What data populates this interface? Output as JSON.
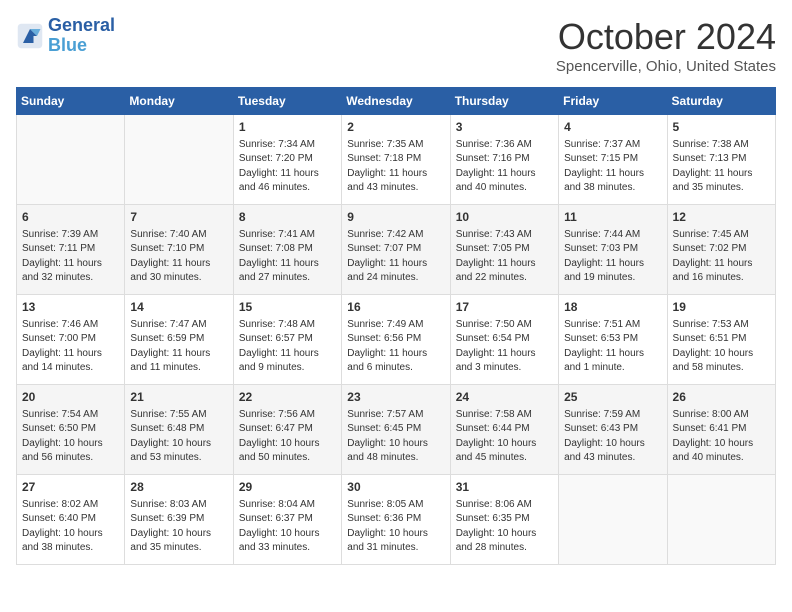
{
  "header": {
    "logo_line1": "General",
    "logo_line2": "Blue",
    "month_year": "October 2024",
    "location": "Spencerville, Ohio, United States"
  },
  "weekdays": [
    "Sunday",
    "Monday",
    "Tuesday",
    "Wednesday",
    "Thursday",
    "Friday",
    "Saturday"
  ],
  "weeks": [
    [
      null,
      null,
      {
        "day": 1,
        "sunrise": "7:34 AM",
        "sunset": "7:20 PM",
        "daylight": "11 hours and 46 minutes."
      },
      {
        "day": 2,
        "sunrise": "7:35 AM",
        "sunset": "7:18 PM",
        "daylight": "11 hours and 43 minutes."
      },
      {
        "day": 3,
        "sunrise": "7:36 AM",
        "sunset": "7:16 PM",
        "daylight": "11 hours and 40 minutes."
      },
      {
        "day": 4,
        "sunrise": "7:37 AM",
        "sunset": "7:15 PM",
        "daylight": "11 hours and 38 minutes."
      },
      {
        "day": 5,
        "sunrise": "7:38 AM",
        "sunset": "7:13 PM",
        "daylight": "11 hours and 35 minutes."
      }
    ],
    [
      {
        "day": 6,
        "sunrise": "7:39 AM",
        "sunset": "7:11 PM",
        "daylight": "11 hours and 32 minutes."
      },
      {
        "day": 7,
        "sunrise": "7:40 AM",
        "sunset": "7:10 PM",
        "daylight": "11 hours and 30 minutes."
      },
      {
        "day": 8,
        "sunrise": "7:41 AM",
        "sunset": "7:08 PM",
        "daylight": "11 hours and 27 minutes."
      },
      {
        "day": 9,
        "sunrise": "7:42 AM",
        "sunset": "7:07 PM",
        "daylight": "11 hours and 24 minutes."
      },
      {
        "day": 10,
        "sunrise": "7:43 AM",
        "sunset": "7:05 PM",
        "daylight": "11 hours and 22 minutes."
      },
      {
        "day": 11,
        "sunrise": "7:44 AM",
        "sunset": "7:03 PM",
        "daylight": "11 hours and 19 minutes."
      },
      {
        "day": 12,
        "sunrise": "7:45 AM",
        "sunset": "7:02 PM",
        "daylight": "11 hours and 16 minutes."
      }
    ],
    [
      {
        "day": 13,
        "sunrise": "7:46 AM",
        "sunset": "7:00 PM",
        "daylight": "11 hours and 14 minutes."
      },
      {
        "day": 14,
        "sunrise": "7:47 AM",
        "sunset": "6:59 PM",
        "daylight": "11 hours and 11 minutes."
      },
      {
        "day": 15,
        "sunrise": "7:48 AM",
        "sunset": "6:57 PM",
        "daylight": "11 hours and 9 minutes."
      },
      {
        "day": 16,
        "sunrise": "7:49 AM",
        "sunset": "6:56 PM",
        "daylight": "11 hours and 6 minutes."
      },
      {
        "day": 17,
        "sunrise": "7:50 AM",
        "sunset": "6:54 PM",
        "daylight": "11 hours and 3 minutes."
      },
      {
        "day": 18,
        "sunrise": "7:51 AM",
        "sunset": "6:53 PM",
        "daylight": "11 hours and 1 minute."
      },
      {
        "day": 19,
        "sunrise": "7:53 AM",
        "sunset": "6:51 PM",
        "daylight": "10 hours and 58 minutes."
      }
    ],
    [
      {
        "day": 20,
        "sunrise": "7:54 AM",
        "sunset": "6:50 PM",
        "daylight": "10 hours and 56 minutes."
      },
      {
        "day": 21,
        "sunrise": "7:55 AM",
        "sunset": "6:48 PM",
        "daylight": "10 hours and 53 minutes."
      },
      {
        "day": 22,
        "sunrise": "7:56 AM",
        "sunset": "6:47 PM",
        "daylight": "10 hours and 50 minutes."
      },
      {
        "day": 23,
        "sunrise": "7:57 AM",
        "sunset": "6:45 PM",
        "daylight": "10 hours and 48 minutes."
      },
      {
        "day": 24,
        "sunrise": "7:58 AM",
        "sunset": "6:44 PM",
        "daylight": "10 hours and 45 minutes."
      },
      {
        "day": 25,
        "sunrise": "7:59 AM",
        "sunset": "6:43 PM",
        "daylight": "10 hours and 43 minutes."
      },
      {
        "day": 26,
        "sunrise": "8:00 AM",
        "sunset": "6:41 PM",
        "daylight": "10 hours and 40 minutes."
      }
    ],
    [
      {
        "day": 27,
        "sunrise": "8:02 AM",
        "sunset": "6:40 PM",
        "daylight": "10 hours and 38 minutes."
      },
      {
        "day": 28,
        "sunrise": "8:03 AM",
        "sunset": "6:39 PM",
        "daylight": "10 hours and 35 minutes."
      },
      {
        "day": 29,
        "sunrise": "8:04 AM",
        "sunset": "6:37 PM",
        "daylight": "10 hours and 33 minutes."
      },
      {
        "day": 30,
        "sunrise": "8:05 AM",
        "sunset": "6:36 PM",
        "daylight": "10 hours and 31 minutes."
      },
      {
        "day": 31,
        "sunrise": "8:06 AM",
        "sunset": "6:35 PM",
        "daylight": "10 hours and 28 minutes."
      },
      null,
      null
    ]
  ]
}
